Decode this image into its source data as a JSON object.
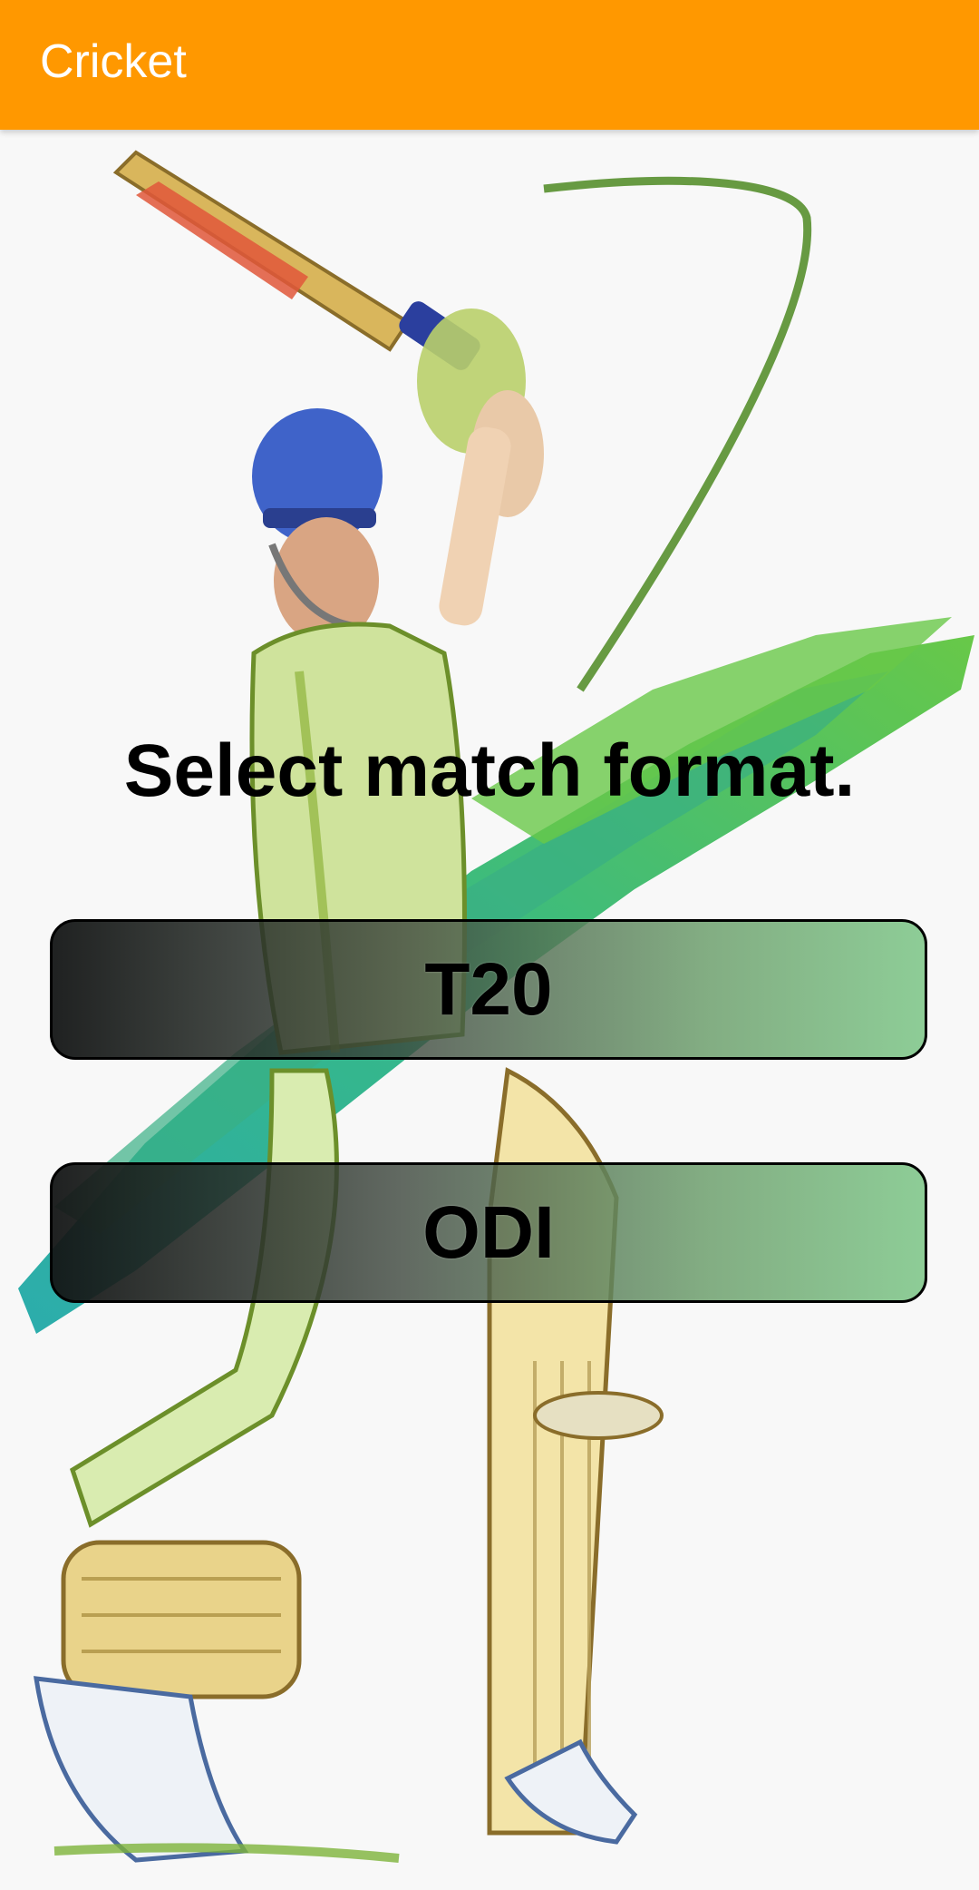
{
  "app_bar": {
    "title": "Cricket"
  },
  "main": {
    "heading": "Select match format.",
    "formats": [
      {
        "label": "T20"
      },
      {
        "label": "ODI"
      }
    ]
  },
  "colors": {
    "app_bar": "#ff9800",
    "background": "#f8f8f8",
    "paint_green": "#5cc43a",
    "paint_teal": "#1aa6a6"
  },
  "illustration": {
    "name": "cricket-batsman-illustration"
  }
}
